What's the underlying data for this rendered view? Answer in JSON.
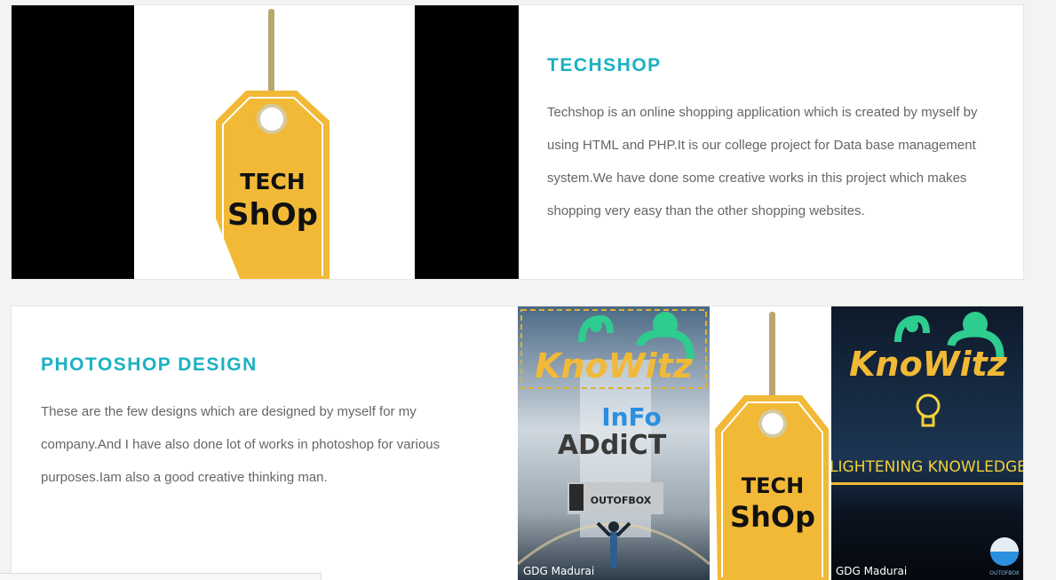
{
  "projects": [
    {
      "title": "TECHSHOP",
      "description": "Techshop is an online shopping application which is created by myself by using HTML and PHP.It is our college project for Data base management system.We have done some creative works in this project which makes shopping very easy than the other shopping websites.",
      "image": {
        "tag_line1": "TECH",
        "tag_line2": "ShOp",
        "tag_color": "#f2b937"
      }
    },
    {
      "title": "PHOTOSHOP DESIGN",
      "description": "These are the few designs which are designed by myself for my company.And I have also done lot of works in photoshop for various purposes.Iam also a good creative thinking man.",
      "images": {
        "poster1": {
          "brand": "KnoWitz",
          "headline1": "InFo",
          "headline2": "ADdiCT",
          "badge": "OUTOFBOX",
          "footer": "GDG Madurai"
        },
        "poster2": {
          "tag_line1": "TECH",
          "tag_line2": "ShOp"
        },
        "poster3": {
          "brand": "KnoWitz",
          "tagline": "LIGHTENING KNOWLEDGE",
          "footer": "GDG Madurai",
          "badge": "OUTOFBOX"
        }
      }
    }
  ],
  "colors": {
    "accent": "#1bb1c1",
    "brand_green": "#2ecc8f",
    "brand_yellow": "#f2b937"
  }
}
